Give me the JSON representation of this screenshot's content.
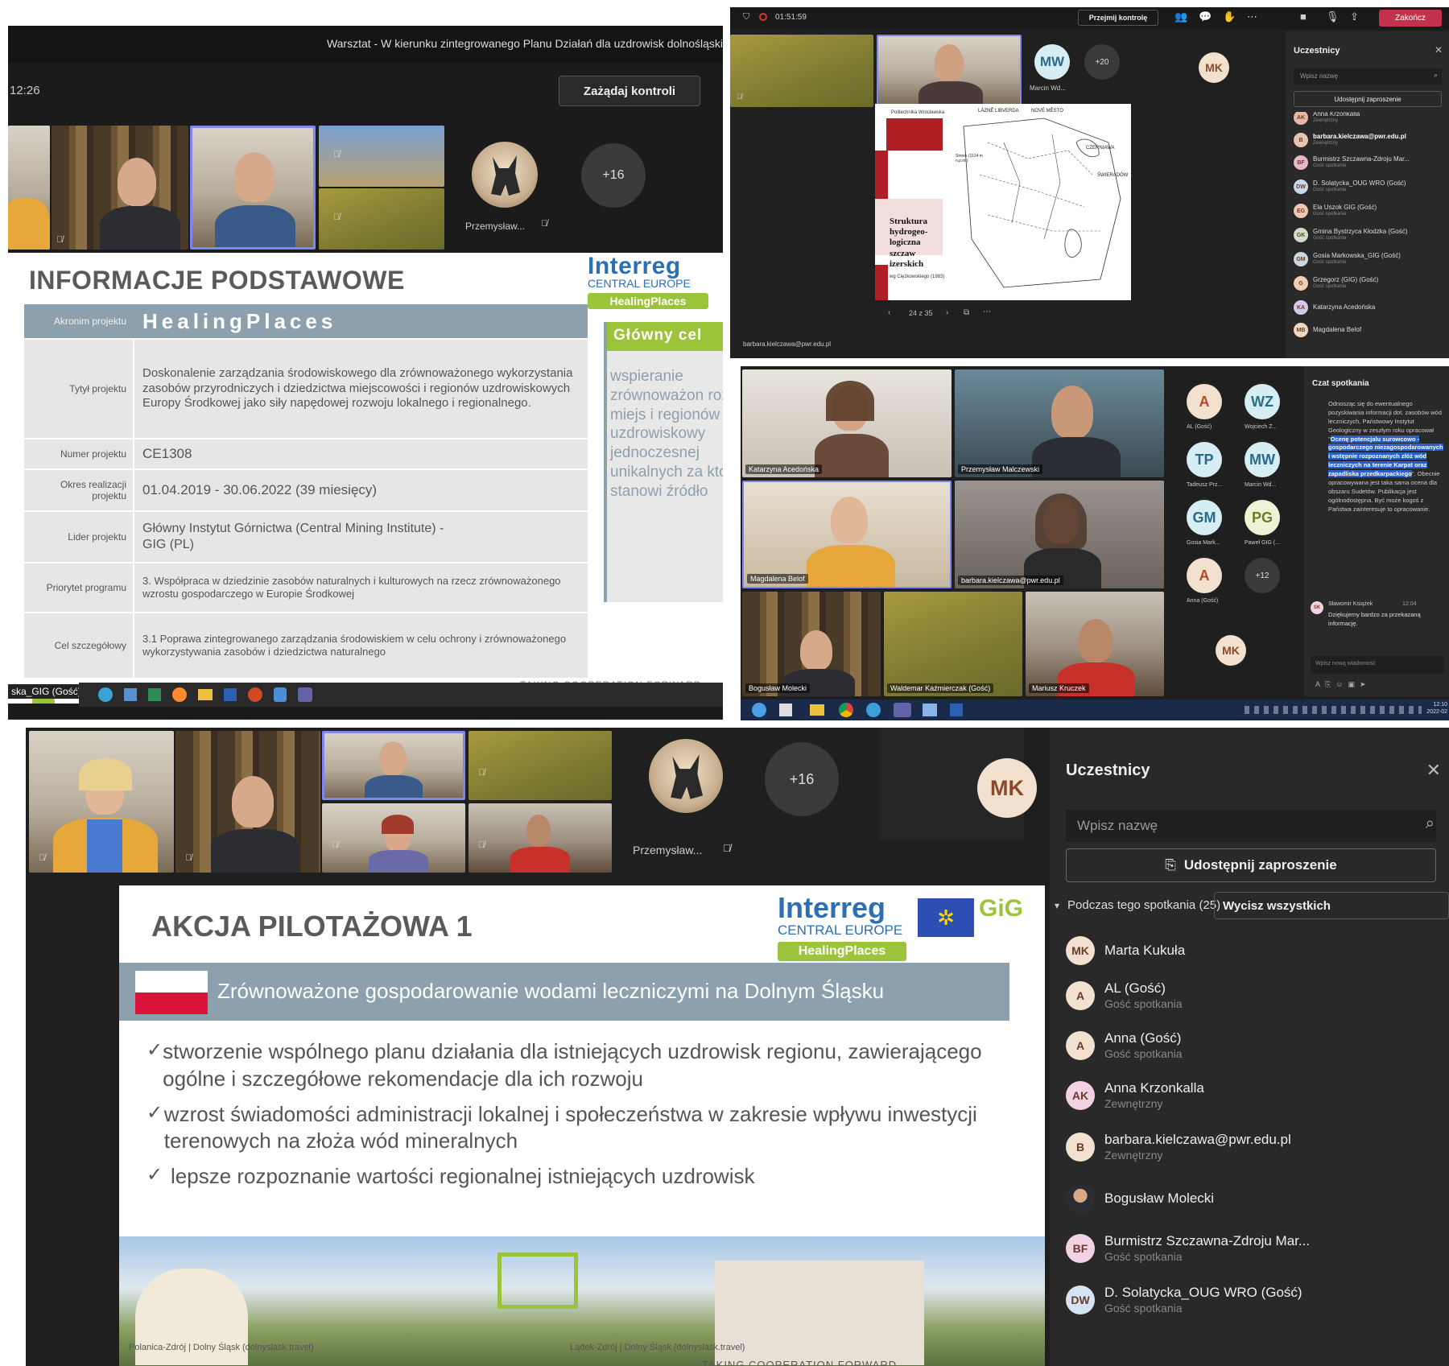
{
  "s1": {
    "meeting_title": "Warsztat - W kierunku zintegrowanego Planu Działań dla uzdrowisk dolnośląski",
    "time": "12:26",
    "request_control": "Zażądaj kontroli",
    "participant_przemyslaw": "Przemysław...",
    "more_count": "+16",
    "slide": {
      "heading": "INFORMACJE PODSTAWOWE",
      "logo_main": "Interreg",
      "logo_sub": "CENTRAL EUROPE",
      "logo_project": "HealingPlaces",
      "rows": [
        {
          "label": "Akronim projektu",
          "value": "HealingPlaces"
        },
        {
          "label": "Tytył projektu",
          "value": "Doskonalenie zarządzania środowiskowego dla zrównoważonego wykorzystania zasobów przyrodniczych i dziedzictwa miejscowości i regionów uzdrowiskowych Europy Środkowej jako siły napędowej rozwoju lokalnego i regionalnego."
        },
        {
          "label": "Numer projektu",
          "value": "CE1308"
        },
        {
          "label": "Okres realizacji projektu",
          "value": "01.04.2019 - 30.06.2022 (39 miesięcy)"
        },
        {
          "label": "Lider projektu",
          "value": "Główny Instytut Górnictwa (Central Mining Institute) - GIG (PL)"
        },
        {
          "label": "Priorytet programu",
          "value": "3. Współpraca w dziedzinie zasobów naturalnych i kulturowych na rzecz zrównoważonego wzrostu gospodarczego w Europie Środkowej"
        },
        {
          "label": "Cel szczegółowy",
          "value": "3.1 Poprawa zintegrowanego zarządzania środowiskiem w celu ochrony i zrównoważonego wykorzystywania zasobów i dziedzictwa naturalnego"
        }
      ],
      "goal_heading": "Główny cel",
      "goal_text": "wspieranie zrównoważon rozwoju miejs i regionów uzdrowiskowy jednoczesnej unikalnych za które stanowi źródło",
      "footer": "TAKING COOPERATION FORWARD",
      "presenter_tag": "ska_GIG (Gość)"
    }
  },
  "s2": {
    "timer": "01:51:59",
    "take_control": "Przejmij kontrolę",
    "leave": "Zakończ",
    "avatars": [
      {
        "initials": "MW",
        "name": "Marcin Wd..."
      },
      {
        "initials": "+20",
        "name": ""
      },
      {
        "initials": "MK",
        "name": ""
      }
    ],
    "map_header": "Politechnika Wrocławska",
    "map_labels": [
      "LÁZNĚ LIBVERDA",
      "NOVÉ MĚSTO",
      "CZERNIAWA",
      "ŚWIERADÓW",
      "Smrek (1124 m n.p.m.)"
    ],
    "map_caption": "Struktura hydrogeo-logiczna szczaw izerskich",
    "map_source": "wg Ciężkowskiego (1983)",
    "page": "24 z 35",
    "presenter": "barbara.kielczawa@pwr.edu.pl",
    "panel_title": "Uczestnicy",
    "search_placeholder": "Wpisz nazwę",
    "share_invite": "Udostępnij zaproszenie",
    "people": [
      {
        "initials": "AK",
        "name": "Anna Krzonkalla",
        "role": "Zewnętrzny",
        "color": "#e7b8a8"
      },
      {
        "initials": "B",
        "name": "barbara.kielczawa@pwr.edu.pl",
        "role": "Zewnętrzny",
        "color": "#e7c3b0"
      },
      {
        "initials": "BF",
        "name": "Burmistrz Szczawna-Zdroju Mar...",
        "role": "Gość spotkania",
        "color": "#e7b8c8"
      },
      {
        "initials": "DW",
        "name": "D. Solatycka_OUG WRO (Gość)",
        "role": "Gość spotkania",
        "color": "#c7d8e8"
      },
      {
        "initials": "EG",
        "name": "Ela Uszok GIG (Gość)",
        "role": "Gość spotkania",
        "color": "#f0c8b0"
      },
      {
        "initials": "GK",
        "name": "Gmina Bystrzyca Kłodzka (Gość)",
        "role": "Gość spotkania",
        "color": "#d0e0c8"
      },
      {
        "initials": "GM",
        "name": "Gosia Markowska_GIG (Gość)",
        "role": "Gość spotkania",
        "color": "#c8d8e0"
      },
      {
        "initials": "G",
        "name": "Grzegorz (GIG) (Gość)",
        "role": "Gość spotkania",
        "color": "#f0d0b0"
      },
      {
        "initials": "KA",
        "name": "Katarzyna Acedońska",
        "role": "",
        "color": "#d8c8e8"
      },
      {
        "initials": "MB",
        "name": "Magdalena Belof",
        "role": "",
        "color": "#f0d8c0"
      }
    ]
  },
  "s3": {
    "tiles": [
      "Katarzyna Acedońska",
      "Przemysław Malczewski",
      "Magdalena Belof",
      "barbara.kielczawa@pwr.edu.pl",
      "Bogusław Molecki",
      "Waldemar Kaźmierczak (Gość)",
      "Mariusz Kruczek"
    ],
    "roster": [
      {
        "initials": "A",
        "name": "AL (Gość)",
        "color": "#f3e1cf",
        "fg": "#b04a2a"
      },
      {
        "initials": "WZ",
        "name": "Wojciech Z...",
        "color": "#d6eef3",
        "fg": "#2a6a8a"
      },
      {
        "initials": "TP",
        "name": "Tadeusz Prz...",
        "color": "#d6eef3",
        "fg": "#2a6a8a"
      },
      {
        "initials": "MW",
        "name": "Marcin Wd...",
        "color": "#d6eef3",
        "fg": "#2a6a8a"
      },
      {
        "initials": "GM",
        "name": "Gosia Mark...",
        "color": "#d6eef3",
        "fg": "#2a6a8a"
      },
      {
        "initials": "PG",
        "name": "Paweł GIG (...",
        "color": "#eef3d6",
        "fg": "#6a7a2a"
      },
      {
        "initials": "A",
        "name": "Anna (Gość)",
        "color": "#f3e1cf",
        "fg": "#b04a2a"
      },
      {
        "initials": "+12",
        "name": "",
        "color": "#3a3a3a",
        "fg": "#dddddd"
      }
    ],
    "mk": "MK",
    "chat_title": "Czat spotkania",
    "chat_text_1": "Odnosząc się do ewentualnego pozyskiwania informacji dot. zasobów wód leczniczych, Państwowy Instytut Geologiczny w zeszłym roku opracował \"",
    "chat_highlight": "Ocenę potencjału surowcowo - gospodarczego niezagospodarowanych i wstępnie rozpoznanych złóż wód leczniczych na terenie Karpat oraz zapadliska przedkarpackiego",
    "chat_text_2": "\". Obecnie opracowywana jest taka sama ocena dla obszaru Sudetów. Publikacja jest ogólnodostępna. Być może kogoś z Państwa zainteresuje to opracowanie.",
    "chat_author": "Sławomir Książek",
    "chat_time": "12:04",
    "chat_reply": "Dziękujemy bardzo za przekazaną informację.",
    "chat_input": "Wpisz nową wiadomość",
    "clock": "12:10",
    "date": "2022-02"
  },
  "s4": {
    "participant_przemyslaw": "Przemysław...",
    "more_count": "+16",
    "mk": "MK",
    "slide": {
      "heading": "AKCJA PILOTAŻOWA 1",
      "logo_main": "Interreg",
      "logo_sub": "CENTRAL EUROPE",
      "logo_project": "HealingPlaces",
      "logo_gig": "GiG",
      "banner": "Zrównoważone gospodarowanie wodami leczniczymi na Dolnym Śląsku",
      "bullets": [
        "stworzenie wspólnego planu działania dla istniejących uzdrowisk regionu, zawierającego ogólne i szczegółowe rekomendacje dla ich rozwoju",
        "wzrost świadomości administracji lokalnej i społeczeństwa w zakresie wpływu inwestycji terenowych na złoża wód mineralnych",
        "lepsze rozpoznanie wartości regionalnej istniejących uzdrowisk"
      ],
      "caption_left": "Polanica-Zdrój | Dolny Śląsk (dolnyslask.travel)",
      "caption_right": "Lądek-Zdrój | Dolny Śląsk (dolnyslask.travel)",
      "footer": "TAKING COOPERATION FORWARD"
    },
    "panel_title": "Uczestnicy",
    "search_placeholder": "Wpisz nazwę",
    "share_invite": "Udostępnij zaproszenie",
    "section_label": "Podczas tego spotkania (25)",
    "mute_all": "Wycisz wszystkich",
    "people": [
      {
        "initials": "MK",
        "name": "Marta Kukuła",
        "role": "",
        "color": "#f3e1cf"
      },
      {
        "initials": "A",
        "name": "AL (Gość)",
        "role": "Gość spotkania",
        "color": "#f3e1cf"
      },
      {
        "initials": "A",
        "name": "Anna (Gość)",
        "role": "Gość spotkania",
        "color": "#f3e1cf"
      },
      {
        "initials": "AK",
        "name": "Anna Krzonkalla",
        "role": "Zewnętrzny",
        "color": "#f3d3e3"
      },
      {
        "initials": "B",
        "name": "barbara.kielczawa@pwr.edu.pl",
        "role": "Zewnętrzny",
        "color": "#f3e1cf"
      },
      {
        "initials": "",
        "name": "Bogusław Molecki",
        "role": "",
        "color": "#7a6a5a"
      },
      {
        "initials": "BF",
        "name": "Burmistrz Szczawna-Zdroju Mar...",
        "role": "Gość spotkania",
        "color": "#f3d3e3"
      },
      {
        "initials": "DW",
        "name": "D. Solatycka_OUG WRO (Gość)",
        "role": "Gość spotkania",
        "color": "#d6e3f3"
      }
    ]
  },
  "colors": {
    "teams_bg": "#1f1f1f",
    "slide_table": "#e6e6e6",
    "slide_header": "#8da0ad",
    "interreg_blue": "#2d6fb3",
    "healing_green": "#9cc43a",
    "leave_red": "#c4314b",
    "highlight_blue": "#2a5fc9"
  }
}
